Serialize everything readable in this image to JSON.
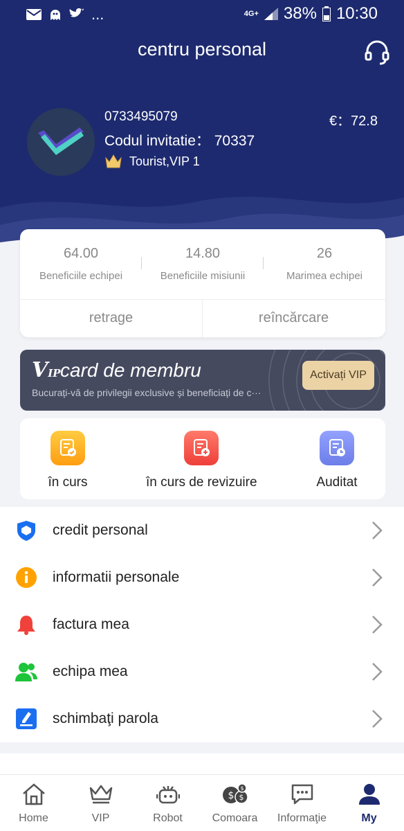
{
  "status_bar": {
    "network": "4G+",
    "battery": "38%",
    "time": "10:30",
    "more": "..."
  },
  "header": {
    "title": "centru personal"
  },
  "profile": {
    "phone": "0733495079",
    "invite_label": "Codul invitatie：",
    "invite_code": "70337",
    "level": "Tourist,VIP 1",
    "balance": "€：72.8"
  },
  "stats": [
    {
      "value": "64.00",
      "label": "Beneficiile echipei"
    },
    {
      "value": "14.80",
      "label": "Beneficiile misiunii"
    },
    {
      "value": "26",
      "label": "Marimea echipei"
    }
  ],
  "actions": {
    "withdraw": "retrage",
    "recharge": "reîncărcare"
  },
  "vip_card": {
    "logo": "V",
    "logo_sub": "IP",
    "title": "card de membru",
    "subtitle": "Bucurați-vă de privilegii exclusive și beneficiați de c···",
    "button": "Activați VIP"
  },
  "task_status": [
    {
      "label": "în curs",
      "icon": "clipboard-check-icon",
      "color": "#ffb424"
    },
    {
      "label": "în curs de revizuire",
      "icon": "clipboard-plus-icon",
      "color": "#f55a4e"
    },
    {
      "label": "Auditat",
      "icon": "clipboard-clock-icon",
      "color": "#7b8cf2"
    }
  ],
  "menu": [
    {
      "label": "credit personal",
      "icon": "shield-icon",
      "color": "#1a6ff0"
    },
    {
      "label": "informatii personale",
      "icon": "info-icon",
      "color": "#ffa200"
    },
    {
      "label": "factura mea",
      "icon": "bell-icon",
      "color": "#f0413a"
    },
    {
      "label": "echipa mea",
      "icon": "team-icon",
      "color": "#1ec43a"
    },
    {
      "label": "schimbaţi parola",
      "icon": "pen-icon",
      "color": "#1a6ff0"
    }
  ],
  "nav": [
    {
      "label": "Home",
      "icon": "home-icon"
    },
    {
      "label": "VIP",
      "icon": "crown-icon"
    },
    {
      "label": "Robot",
      "icon": "robot-icon"
    },
    {
      "label": "Comoara",
      "icon": "coins-icon"
    },
    {
      "label": "Informaţie",
      "icon": "chat-icon"
    },
    {
      "label": "My",
      "icon": "user-icon",
      "active": true
    }
  ],
  "colors": {
    "header_bg": "#1d2a6f",
    "vip_card_bg": "#454a5f",
    "vip_button_bg": "#ebd3a6"
  }
}
